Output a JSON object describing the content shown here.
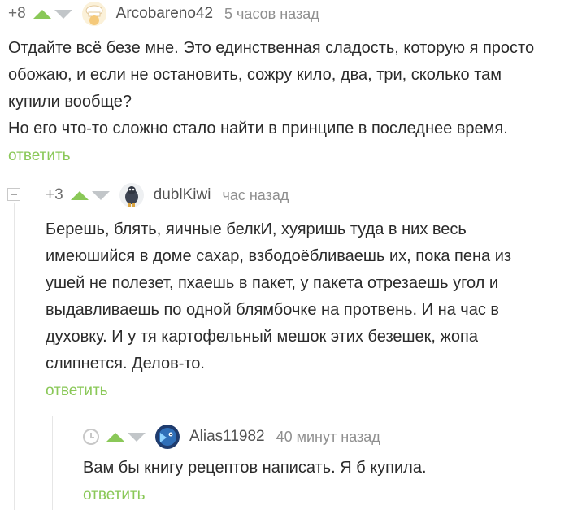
{
  "comments": [
    {
      "rating": "+8",
      "author": "Arcobareno42",
      "time": "5 часов назад",
      "lines": [
        "Отдайте всё безе мне. Это единственная сладость, которую я просто",
        "обожаю, и если не остановить, сожру кило, два, три, сколько там",
        "купили вообще?",
        "Но его что-то сложно стало найти в принципе в последнее время."
      ],
      "reply": "ответить"
    },
    {
      "rating": "+3",
      "author": "dublKiwi",
      "time": "час назад",
      "lines": [
        "Берешь, блять, яичные белкИ, хуяришь туда в них весь",
        "имеюшийся в доме сахар, взбодоёбливаешь их, пока пена из",
        "ушей не полезет, пхаешь в пакет, у пакета отрезаешь угол и",
        "выдавливаешь по одной блямбочке на протвень. И на час в",
        "духовку. И у тя картофельный мешок этих безешек, жопа",
        "слипнется. Делов-то."
      ],
      "reply": "ответить"
    },
    {
      "rating": "",
      "author": "Alias11982",
      "time": "40 минут назад",
      "lines": [
        "Вам бы книгу рецептов написать. Я б купила."
      ],
      "reply": "ответить"
    }
  ],
  "colors": {
    "accent": "#8ac858",
    "downvote": "#c2c6c9",
    "text": "#2b2b2b",
    "meta": "#8f8f8f"
  },
  "icons": {
    "avatar1": "chef-hat-avatar",
    "avatar2": "kiwi-bird-avatar",
    "avatar3": "blue-creature-avatar",
    "pending": "clock-icon"
  }
}
